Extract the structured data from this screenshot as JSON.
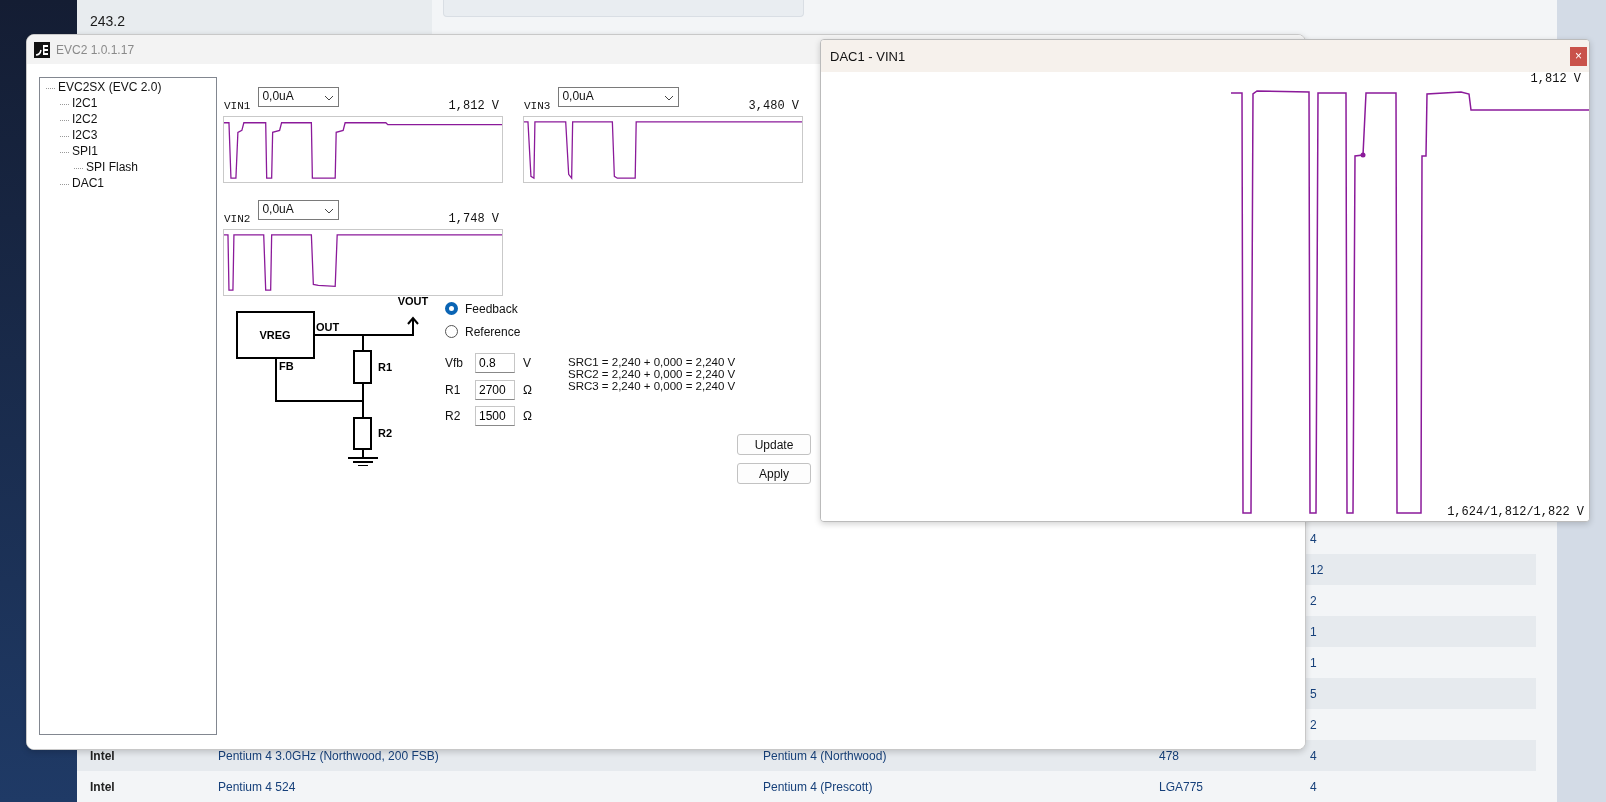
{
  "background_page": {
    "stat_value": "243.2",
    "table_rows": [
      {
        "count": "4"
      },
      {
        "count": "12"
      },
      {
        "count": "2"
      },
      {
        "count": "1"
      },
      {
        "count": "1"
      },
      {
        "count": "5"
      },
      {
        "count": "2"
      },
      {
        "vendor": "Intel",
        "model": "Pentium 4 3.0GHz (Northwood, 200 FSB)",
        "family": "Pentium 4 (Northwood)",
        "socket": "478",
        "count": "4"
      },
      {
        "vendor": "Intel",
        "model": "Pentium 4 524",
        "family": "Pentium 4 (Prescott)",
        "socket": "LGA775",
        "count": "4"
      }
    ]
  },
  "main_window": {
    "title": "EVC2 1.0.1.17",
    "tree": [
      {
        "label": "EVC2SX (EVC 2.0)",
        "children": [
          {
            "label": "I2C1"
          },
          {
            "label": "I2C2"
          },
          {
            "label": "I2C3"
          },
          {
            "label": "SPI1",
            "children": [
              {
                "label": "SPI Flash"
              }
            ]
          },
          {
            "label": "DAC1"
          }
        ]
      }
    ],
    "channels": [
      {
        "name": "VIN1",
        "current": "0,0uA",
        "reading": "1,812 V"
      },
      {
        "name": "VIN3",
        "current": "0,0uA",
        "reading": "3,480 V"
      },
      {
        "name": "VIN2",
        "current": "0,0uA",
        "reading": "1,748 V"
      }
    ],
    "circuit": {
      "block": "VREG",
      "output_pin": "OUT",
      "feedback_pin": "FB",
      "output_label": "VOUT",
      "upper_resistor": "R1",
      "lower_resistor": "R2"
    },
    "modes": [
      {
        "label": "Feedback",
        "selected": true
      },
      {
        "label": "Reference",
        "selected": false
      }
    ],
    "parameters": [
      {
        "label": "Vfb",
        "value": "0.8",
        "unit": "V"
      },
      {
        "label": "R1",
        "value": "2700",
        "unit": "Ω"
      },
      {
        "label": "R2",
        "value": "1500",
        "unit": "Ω"
      }
    ],
    "results": [
      "SRC1 = 2,240 + 0,000 = 2,240 V",
      "SRC2 = 2,240 + 0,000 = 2,240 V",
      "SRC3 = 2,240 + 0,000 = 2,240 V"
    ],
    "buttons": [
      "Update",
      "Apply"
    ]
  },
  "plot_window": {
    "title": "DAC1 - VIN1",
    "close": "×",
    "reading": "1,812 V",
    "summary": "1,624/1,812/1,822 V"
  }
}
